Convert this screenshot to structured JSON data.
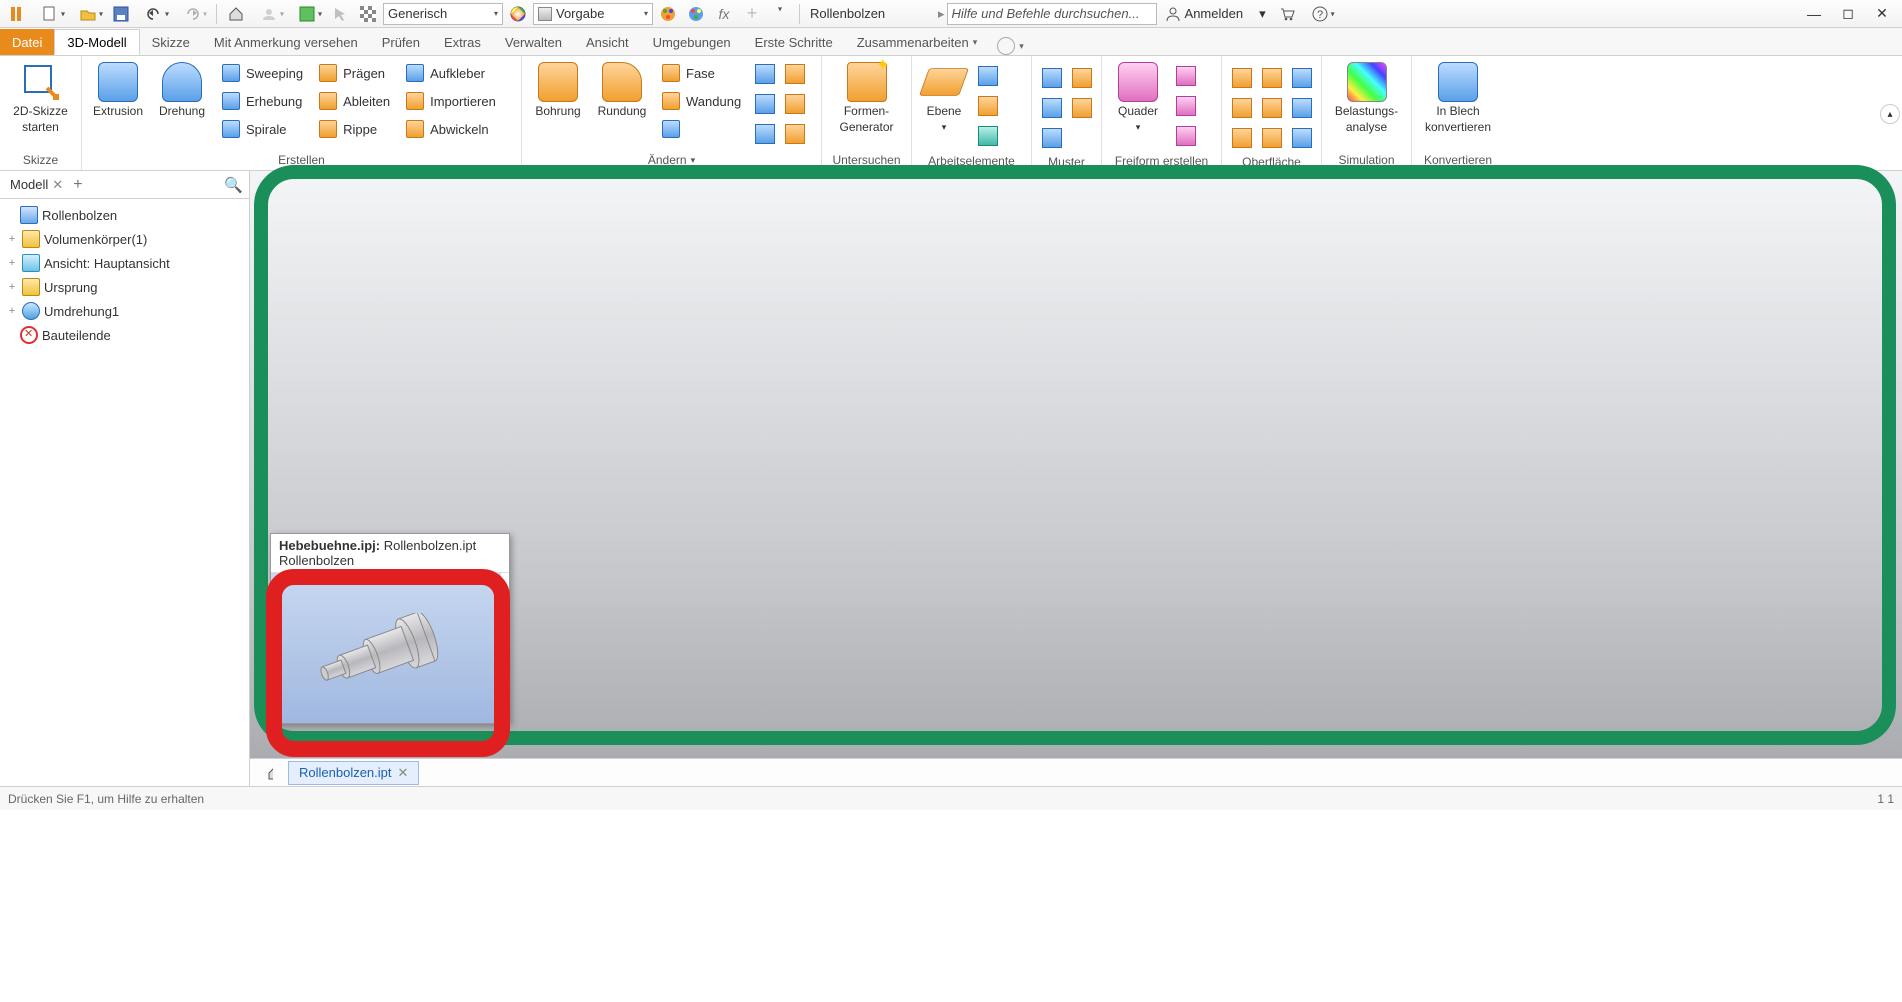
{
  "qat": {
    "material_combo": "Generisch",
    "appearance_combo": "Vorgabe",
    "docname": "Rollenbolzen",
    "search_placeholder": "Hilfe und Befehle durchsuchen...",
    "login": "Anmelden"
  },
  "tabs": {
    "file": "Datei",
    "model3d": "3D-Modell",
    "sketch": "Skizze",
    "annotate": "Mit Anmerkung versehen",
    "inspect": "Prüfen",
    "extras": "Extras",
    "manage": "Verwalten",
    "view": "Ansicht",
    "env": "Umgebungen",
    "start": "Erste Schritte",
    "collab": "Zusammenarbeiten"
  },
  "ribbon": {
    "sketch_group": "Skizze",
    "start_sketch1": "2D-Skizze",
    "start_sketch2": "starten",
    "create_group": "Erstellen",
    "extrusion": "Extrusion",
    "revolve": "Drehung",
    "sweeping": "Sweeping",
    "loft": "Erhebung",
    "coil": "Spirale",
    "emboss": "Prägen",
    "derive": "Ableiten",
    "rib": "Rippe",
    "decal": "Aufkleber",
    "import": "Importieren",
    "unfold": "Abwickeln",
    "modify_group": "Ändern",
    "hole": "Bohrung",
    "fillet": "Rundung",
    "chamfer": "Fase",
    "shell": "Wandung",
    "explore_group": "Untersuchen",
    "shapegen1": "Formen-",
    "shapegen2": "Generator",
    "workfeat_group": "Arbeitselemente",
    "plane": "Ebene",
    "pattern_group": "Muster",
    "freeform_group": "Freiform erstellen",
    "box": "Quader",
    "surface_group": "Oberfläche",
    "sim_group": "Simulation",
    "stress1": "Belastungs-",
    "stress2": "analyse",
    "convert_group": "Konvertieren",
    "sheet1": "In Blech",
    "sheet2": "konvertieren"
  },
  "panel": {
    "tab": "Modell"
  },
  "tree": {
    "root": "Rollenbolzen",
    "solids": "Volumenkörper(1)",
    "view": "Ansicht: Hauptansicht",
    "origin": "Ursprung",
    "rev": "Umdrehung1",
    "end": "Bauteilende"
  },
  "preview": {
    "project": "Hebebuehne.ipj:",
    "file": "Rollenbolzen.ipt",
    "name": "Rollenbolzen"
  },
  "doctab": "Rollenbolzen.ipt",
  "status": {
    "hint": "Drücken Sie F1, um Hilfe zu erhalten",
    "right": "1   1"
  }
}
